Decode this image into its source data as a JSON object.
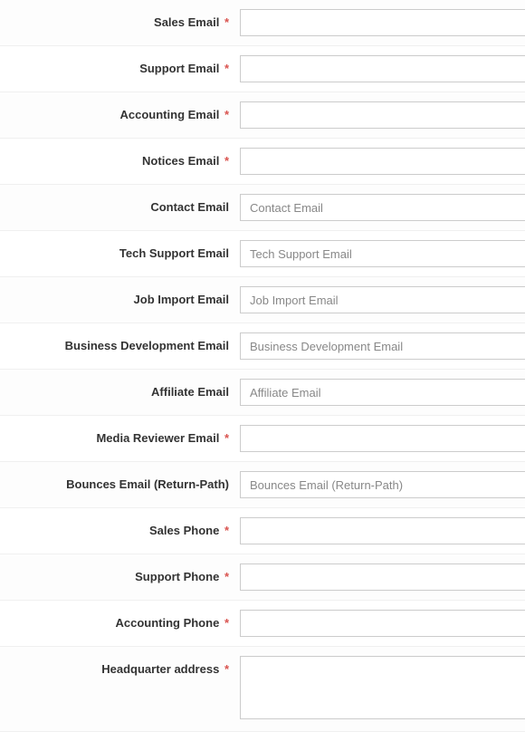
{
  "fields": [
    {
      "label": "Sales Email",
      "required": true,
      "value": "",
      "placeholder": "",
      "type": "text"
    },
    {
      "label": "Support Email",
      "required": true,
      "value": "",
      "placeholder": "",
      "type": "text"
    },
    {
      "label": "Accounting Email",
      "required": true,
      "value": "",
      "placeholder": "",
      "type": "text"
    },
    {
      "label": "Notices Email",
      "required": true,
      "value": "",
      "placeholder": "",
      "type": "text"
    },
    {
      "label": "Contact Email",
      "required": false,
      "value": "",
      "placeholder": "Contact Email",
      "type": "text"
    },
    {
      "label": "Tech Support Email",
      "required": false,
      "value": "",
      "placeholder": "Tech Support Email",
      "type": "text"
    },
    {
      "label": "Job Import Email",
      "required": false,
      "value": "",
      "placeholder": "Job Import Email",
      "type": "text"
    },
    {
      "label": "Business Development Email",
      "required": false,
      "value": "",
      "placeholder": "Business Development Email",
      "type": "text"
    },
    {
      "label": "Affiliate Email",
      "required": false,
      "value": "",
      "placeholder": "Affiliate Email",
      "type": "text"
    },
    {
      "label": "Media Reviewer Email",
      "required": true,
      "value": "",
      "placeholder": "",
      "type": "text"
    },
    {
      "label": "Bounces Email (Return-Path)",
      "required": false,
      "value": "",
      "placeholder": "Bounces Email (Return-Path)",
      "type": "text"
    },
    {
      "label": "Sales Phone",
      "required": true,
      "value": "",
      "placeholder": "",
      "type": "text"
    },
    {
      "label": "Support Phone",
      "required": true,
      "value": "",
      "placeholder": "",
      "type": "text"
    },
    {
      "label": "Accounting Phone",
      "required": true,
      "value": "",
      "placeholder": "",
      "type": "text"
    },
    {
      "label": "Headquarter address",
      "required": true,
      "value": "",
      "placeholder": "",
      "type": "textarea"
    }
  ],
  "required_marker": "*"
}
